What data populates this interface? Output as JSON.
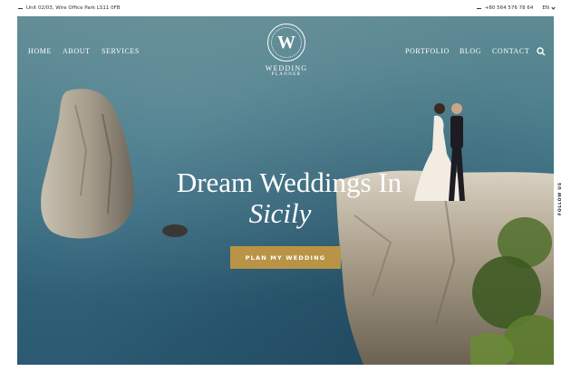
{
  "topbar": {
    "address": "Unit 02/03, Wire Office Park LS11 0FB",
    "phone": "+80 564 576 78 64",
    "language": "EN"
  },
  "nav": {
    "left_items": [
      "HOME",
      "ABOUT",
      "SERVICES"
    ],
    "right_items": [
      "PORTFOLIO",
      "BLOG",
      "CONTACT"
    ]
  },
  "logo": {
    "letter": "W",
    "line1": "WEDDING",
    "line2": "PLANNER"
  },
  "hero": {
    "title_line1": "Dream Weddings In",
    "title_line2": "Sicily",
    "cta_label": "PLAN MY WEDDING"
  },
  "side": {
    "follow_label": "FOLLOW US"
  },
  "icons": {
    "search": "search-icon",
    "chevron": "chevron-down-icon"
  },
  "colors": {
    "accent": "#b99446",
    "sea": "#3f7286"
  }
}
